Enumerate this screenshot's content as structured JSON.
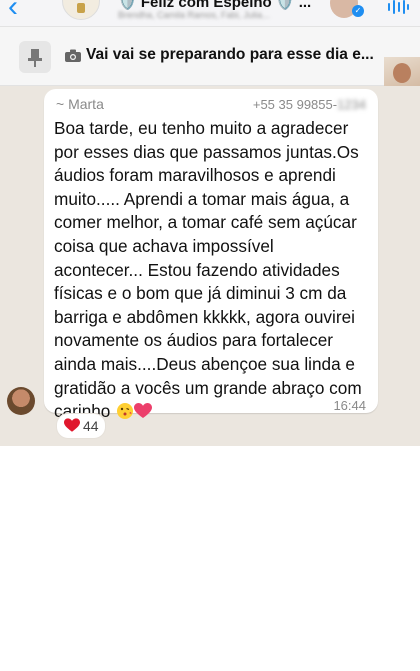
{
  "header": {
    "back_icon": "chevron-left-icon",
    "title": "🛡️ Feliz com Espelho 🛡️ ...",
    "subtitle": "Brendha, Camila Ramos, Fabi, Julia...",
    "call_icon": "audio-wave-icon"
  },
  "pinned": {
    "icon": "pin-icon",
    "media_icon": "camera-icon",
    "text": "Vai vai se preparando para esse dia e..."
  },
  "message": {
    "sender": "~ Marta",
    "phone_visible": "+55 35 99855-",
    "phone_masked": "1234",
    "text": "Boa tarde, eu tenho muito a agradecer\npor esses dias que passamos juntas.Os\náudios foram maravilhosos e aprendi\nmuito..... Aprendi a tomar mais água, a\ncomer melhor, a tomar café sem açúcar\ncoisa que achava impossível\nacontecer... Estou fazendo atividades\nfísicas e o bom que já diminui 3 cm da\nbarriga e abdômen kkkkk, agora ouvirei\nnovamente os áudios para fortalecer\nainda mais....Deus abençoe sua linda e\ngratidão a vocês um grande abraço com\ncarinho",
    "time": "16:44",
    "reaction_count": "44",
    "colors": {
      "bubble": "#ffffff",
      "chat_bg": "#ebe6df",
      "accent": "#1f8ef1"
    }
  }
}
